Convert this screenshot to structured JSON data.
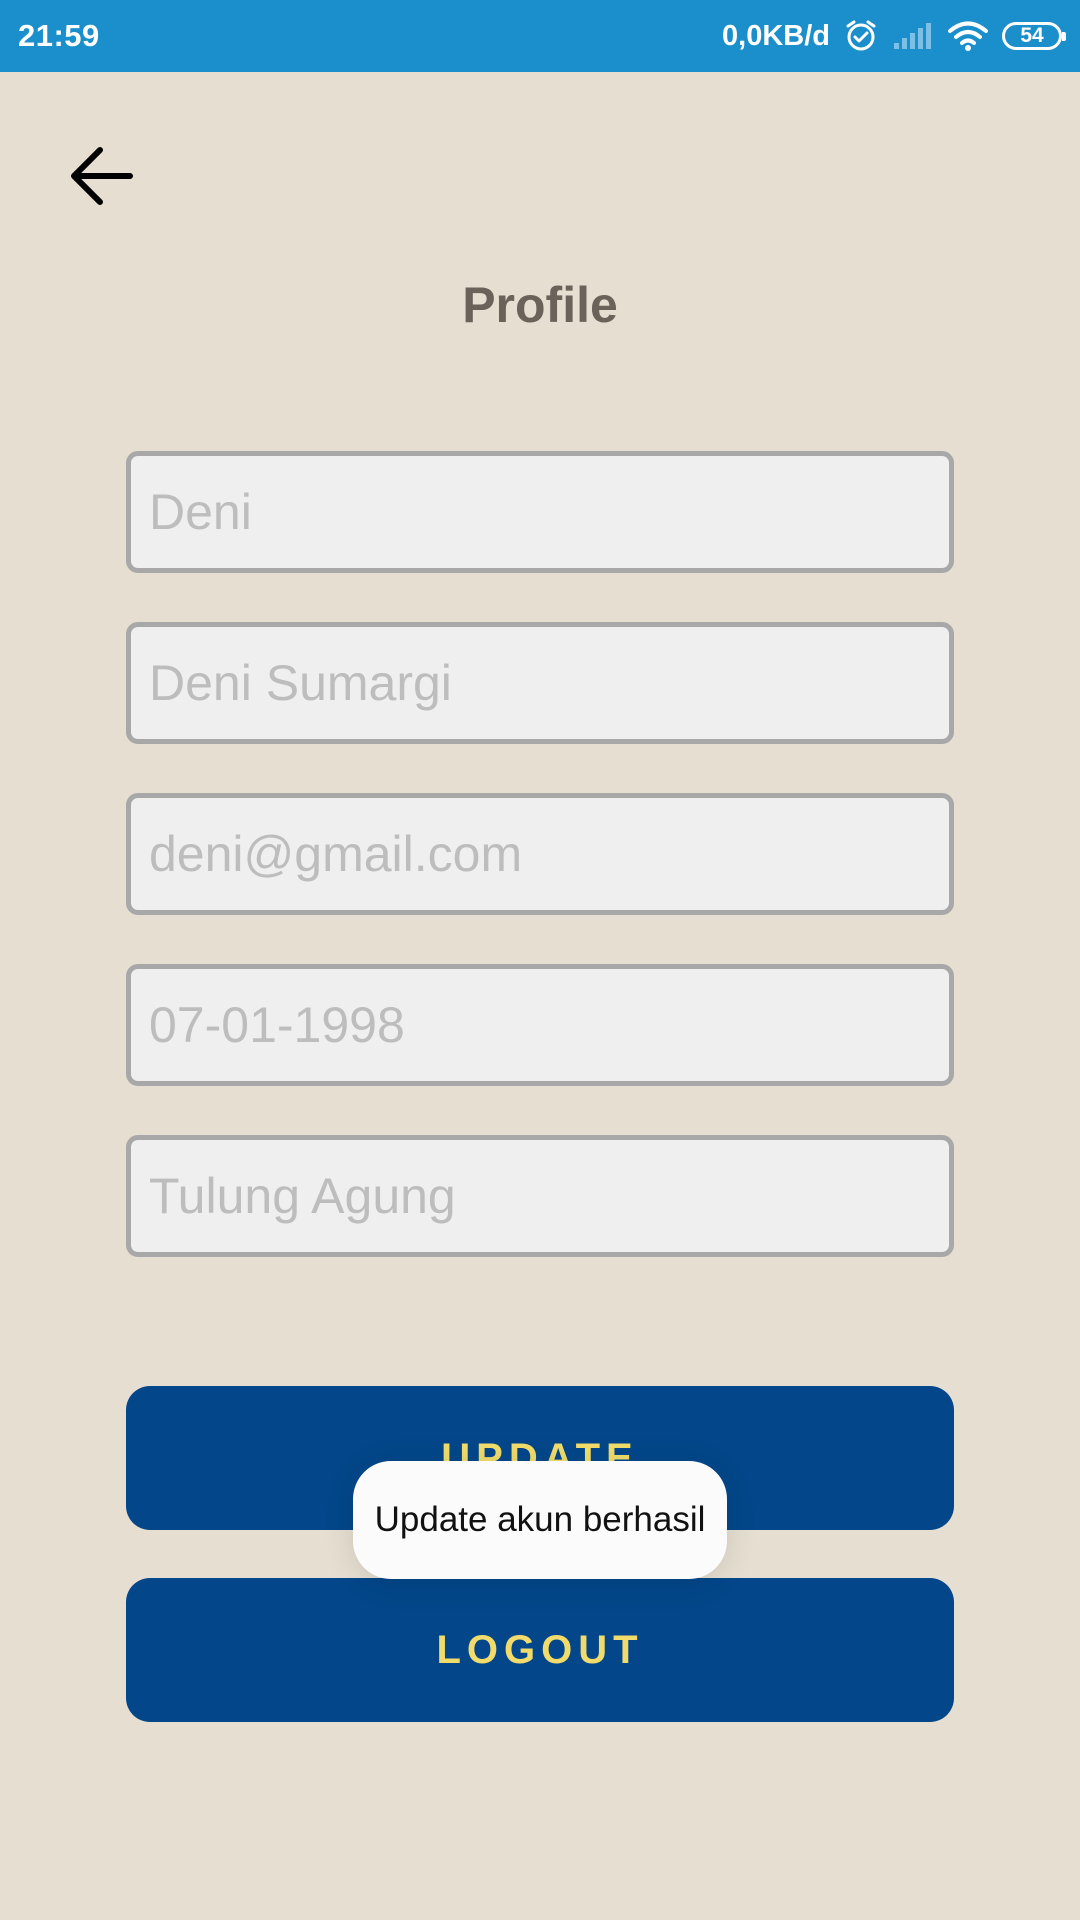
{
  "status_bar": {
    "time": "21:59",
    "network_speed": "0,0KB/d",
    "battery": "54",
    "icons": [
      "alarm-icon",
      "signal-icon",
      "wifi-icon",
      "battery-icon"
    ]
  },
  "header": {
    "back_icon": "arrow-left-icon",
    "title": "Profile"
  },
  "form": {
    "username_placeholder": "Deni",
    "fullname_placeholder": "Deni Sumargi",
    "email_placeholder": "deni@gmail.com",
    "birthdate_placeholder": "07-01-1998",
    "city_placeholder": "Tulung Agung"
  },
  "buttons": {
    "update_label": "UPDATE",
    "logout_label": "LOGOUT"
  },
  "toast": {
    "message": "Update akun berhasil"
  },
  "colors": {
    "status_bar": "#1b8fcb",
    "background": "#e6dfd1",
    "button": "#03478a",
    "button_text": "#f1dc6b",
    "title": "#6b625a"
  }
}
